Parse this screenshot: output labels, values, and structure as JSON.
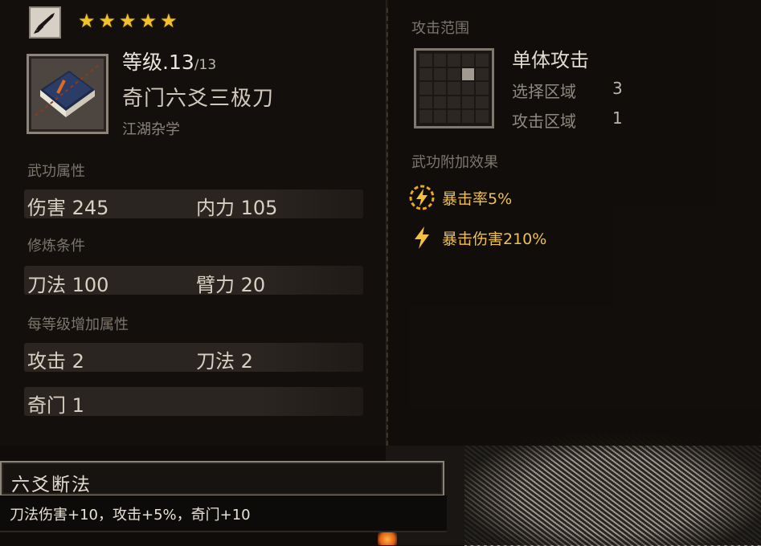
{
  "header": {
    "stars": 5
  },
  "skill": {
    "level_prefix": "等级",
    "level_sep": ".",
    "level": "13",
    "level_max": "/13",
    "name": "奇门六爻三极刀",
    "category": "江湖杂学",
    "icon": "book-icon",
    "type_icon": "blade-icon"
  },
  "attributes": {
    "label": "武功属性",
    "items": [
      {
        "name": "伤害",
        "value": "245"
      },
      {
        "name": "内力",
        "value": "105"
      }
    ]
  },
  "requirements": {
    "label": "修炼条件",
    "items": [
      {
        "name": "刀法",
        "value": "100"
      },
      {
        "name": "臂力",
        "value": "20"
      }
    ]
  },
  "per_level": {
    "label": "每等级增加属性",
    "items": [
      {
        "name": "攻击",
        "value": "2"
      },
      {
        "name": "刀法",
        "value": "2"
      },
      {
        "name": "奇门",
        "value": "1"
      }
    ]
  },
  "range": {
    "label": "攻击范围",
    "title": "单体攻击",
    "select_label": "选择区域",
    "select_value": "3",
    "attack_label": "攻击区域",
    "attack_value": "1"
  },
  "effects": {
    "label": "武功附加效果",
    "items": [
      {
        "text": "暴击率5%",
        "icon": "lightning-circle-icon"
      },
      {
        "text": "暴击伤害210%",
        "icon": "lightning-icon"
      }
    ]
  },
  "tooltip": {
    "title": "六爻断法",
    "desc": "刀法伤害+10，攻击+5%，奇门+10"
  },
  "colors": {
    "star": "#f2c12e",
    "effect_text": "#f0c050",
    "panel_bg": "#120f0d"
  }
}
